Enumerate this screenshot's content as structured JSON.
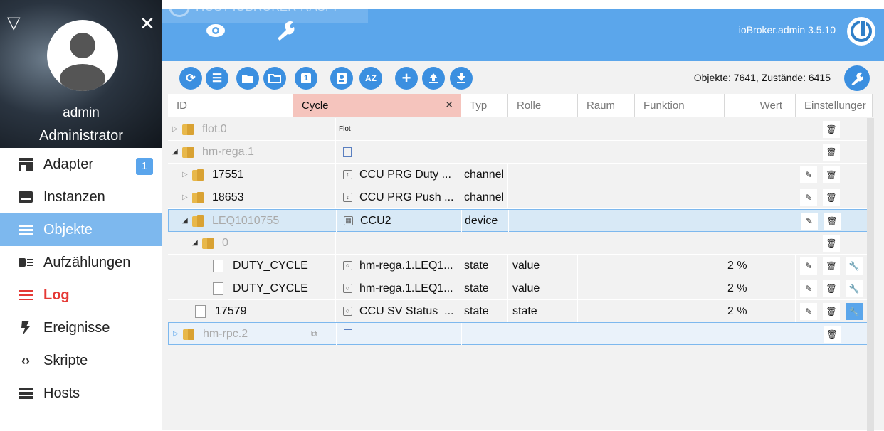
{
  "profile": {
    "name": "admin",
    "role": "Administrator"
  },
  "nav": [
    {
      "label": "Adapter",
      "icon": "store-icon",
      "badge": "1"
    },
    {
      "label": "Instanzen",
      "icon": "keyboard-icon"
    },
    {
      "label": "Objekte",
      "icon": "list-icon",
      "active": true
    },
    {
      "label": "Aufzählungen",
      "icon": "enum-icon"
    },
    {
      "label": "Log",
      "icon": "log-lines-icon"
    },
    {
      "label": "Ereignisse",
      "icon": "bolt-icon"
    },
    {
      "label": "Skripte",
      "icon": "code-icon"
    },
    {
      "label": "Hosts",
      "icon": "server-icon"
    }
  ],
  "topbar": {
    "host": "HOST IOBROKER-RASPI",
    "version": "ioBroker.admin 3.5.10"
  },
  "toolbar": {
    "counts": "Objekte: 7641, Zustände: 6415",
    "sort_label": "AZ",
    "count_badge": "1"
  },
  "table": {
    "headers": {
      "id": "ID",
      "name_filter": "Cycle",
      "type": "Typ",
      "role": "Rolle",
      "room": "Raum",
      "function": "Funktion",
      "value": "Wert",
      "settings": "Einstellunger"
    },
    "rows": [
      {
        "id": "flot.0",
        "name": "Flot",
        "type": "",
        "role": "",
        "value": ""
      },
      {
        "id": "hm-rega.1",
        "name": "",
        "type": "",
        "role": "",
        "value": ""
      },
      {
        "id": "17551",
        "name": "CCU PRG Duty ...",
        "type": "channel",
        "role": "",
        "value": ""
      },
      {
        "id": "18653",
        "name": "CCU PRG Push ...",
        "type": "channel",
        "role": "",
        "value": ""
      },
      {
        "id": "LEQ1010755",
        "name": "CCU2",
        "type": "device",
        "role": "",
        "value": ""
      },
      {
        "id": "0",
        "name": "",
        "type": "",
        "role": "",
        "value": ""
      },
      {
        "id": "DUTY_CYCLE",
        "name": "hm-rega.1.LEQ1...",
        "type": "state",
        "role": "value",
        "value": "2 %"
      },
      {
        "id": "DUTY_CYCLE",
        "name": "hm-rega.1.LEQ1...",
        "type": "state",
        "role": "value",
        "value": "2 %"
      },
      {
        "id": "17579",
        "name": "CCU SV Status_...",
        "type": "state",
        "role": "state",
        "value": "2 %"
      },
      {
        "id": "hm-rpc.2",
        "name": "",
        "type": "",
        "role": "",
        "value": ""
      }
    ]
  }
}
